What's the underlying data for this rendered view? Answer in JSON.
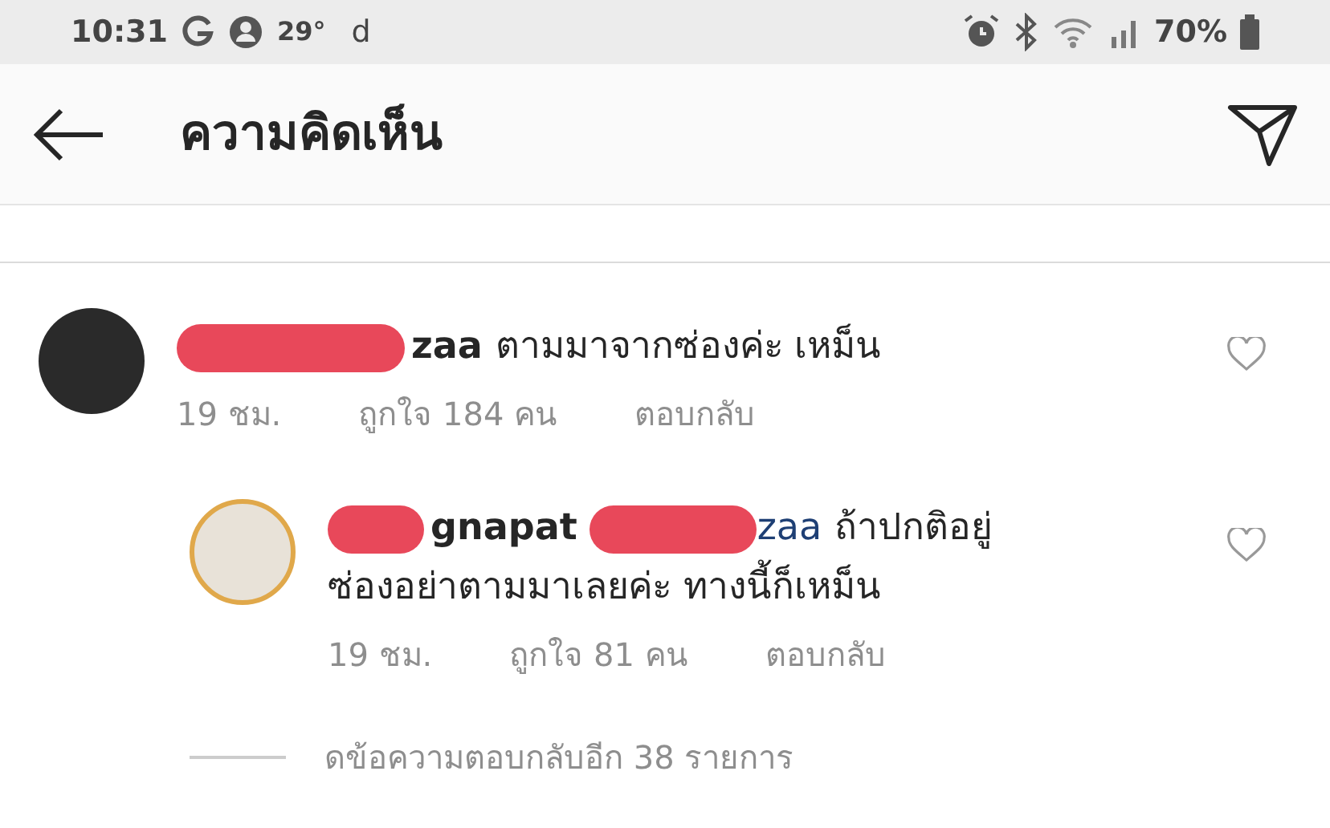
{
  "status_bar": {
    "time": "10:31",
    "temperature": "29°",
    "app_letter": "d",
    "battery": "70%"
  },
  "header": {
    "title": "ความคิดเห็น"
  },
  "comments": [
    {
      "author": "zaa",
      "text": "ตามมาจากซ่องค่ะ เหม็น",
      "time": "19 ชม.",
      "likes": "ถูกใจ 184 คน",
      "reply": "ตอบกลับ",
      "liked": false,
      "avatar_ring": false
    },
    {
      "author": "gnapat",
      "mention": "zaa",
      "text_lines": [
        "ถ้าปกติอยู่",
        "ซ่องอย่าตามมาเลยค่ะ ทางนี้ก็เหม็น"
      ],
      "time": "19 ชม.",
      "likes": "ถูกใจ 81 คน",
      "reply": "ตอบกลับ",
      "liked": false,
      "avatar_ring": true
    }
  ],
  "view_replies": "ดข้อความตอบกลับอีก 38 รายการ"
}
